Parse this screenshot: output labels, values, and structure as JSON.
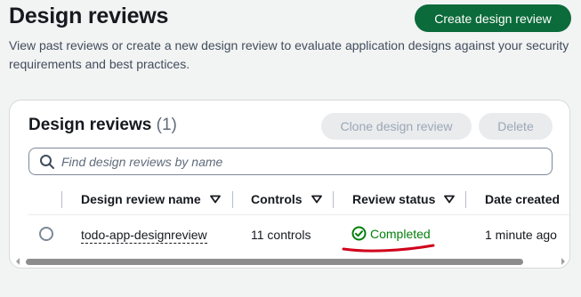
{
  "header": {
    "title": "Design reviews",
    "create_button": "Create design review",
    "description": "View past reviews or create a new design review to evaluate application designs against your security requirements and best practices."
  },
  "card": {
    "title": "Design reviews",
    "count": "(1)",
    "clone_button": "Clone design review",
    "delete_button": "Delete",
    "search": {
      "placeholder": "Find design reviews by name",
      "value": ""
    },
    "columns": [
      {
        "label": "Design review name",
        "sortable": true
      },
      {
        "label": "Controls",
        "sortable": true
      },
      {
        "label": "Review status",
        "sortable": true
      },
      {
        "label": "Date created",
        "sortable": false
      }
    ],
    "rows": [
      {
        "selected": false,
        "name": "todo-app-designreview",
        "controls": "11 controls",
        "status": "Completed",
        "date_created": "1 minute ago"
      }
    ]
  },
  "colors": {
    "primary_button": "#0b6b3a",
    "status_success": "#037f0c",
    "annotation": "#d0021b"
  },
  "icons": {
    "search": "search-icon",
    "sort": "sort-caret-icon",
    "status": "check-circle-icon"
  }
}
